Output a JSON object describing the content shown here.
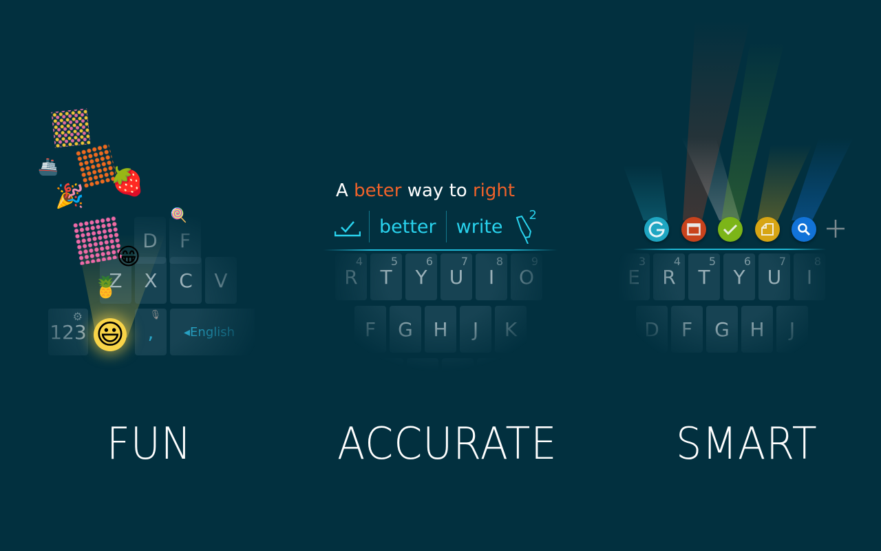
{
  "colors": {
    "background": "#02303f",
    "accent": "#29d3ee",
    "error": "#f0622a",
    "emoji_glow": "#f8d448"
  },
  "fun": {
    "caption": "FUN",
    "rows": [
      [
        {
          "label": "D"
        },
        {
          "label": "F"
        }
      ],
      [
        {
          "label": "Z"
        },
        {
          "label": "X"
        },
        {
          "label": "C"
        },
        {
          "label": "V"
        }
      ]
    ],
    "bottom": {
      "numbers_key": "123",
      "comma_key": ",",
      "space_label": "English"
    },
    "emojis": [
      "🎉",
      "🚢",
      "🍓",
      "🍭",
      "😁",
      "🍍",
      "😃"
    ],
    "icons": [
      "gear-icon",
      "microphone-icon",
      "smiley-icon"
    ]
  },
  "accurate": {
    "caption": "ACCURATE",
    "sentence": [
      {
        "text": "A ",
        "error": false
      },
      {
        "text": "beter",
        "error": true
      },
      {
        "text": " way to ",
        "error": false
      },
      {
        "text": "right",
        "error": true
      }
    ],
    "suggestions": [
      "better",
      "write"
    ],
    "highlighter_count": "2",
    "rows": [
      [
        {
          "label": "R",
          "num": "4"
        },
        {
          "label": "T",
          "num": "5"
        },
        {
          "label": "Y",
          "num": "6"
        },
        {
          "label": "U",
          "num": "7"
        },
        {
          "label": "I",
          "num": "8"
        },
        {
          "label": "O",
          "num": "9"
        }
      ],
      [
        {
          "label": "F"
        },
        {
          "label": "G"
        },
        {
          "label": "H"
        },
        {
          "label": "J"
        },
        {
          "label": "K"
        }
      ]
    ]
  },
  "smart": {
    "caption": "SMART",
    "apps": [
      {
        "icon": "grammar-g-icon",
        "color": "#1fa6c2"
      },
      {
        "icon": "window-icon",
        "color": "#c8431d"
      },
      {
        "icon": "check-icon",
        "color": "#7cb518"
      },
      {
        "icon": "note-icon",
        "color": "#d7a514"
      },
      {
        "icon": "search-icon",
        "color": "#1273d8"
      }
    ],
    "add_icon": "plus-icon",
    "rows": [
      [
        {
          "label": "E",
          "num": "3"
        },
        {
          "label": "R",
          "num": "4"
        },
        {
          "label": "T",
          "num": "5"
        },
        {
          "label": "Y",
          "num": "6"
        },
        {
          "label": "U",
          "num": "7"
        },
        {
          "label": "I",
          "num": "8"
        }
      ],
      [
        {
          "label": "D"
        },
        {
          "label": "F"
        },
        {
          "label": "G"
        },
        {
          "label": "H"
        },
        {
          "label": "J"
        }
      ]
    ]
  }
}
